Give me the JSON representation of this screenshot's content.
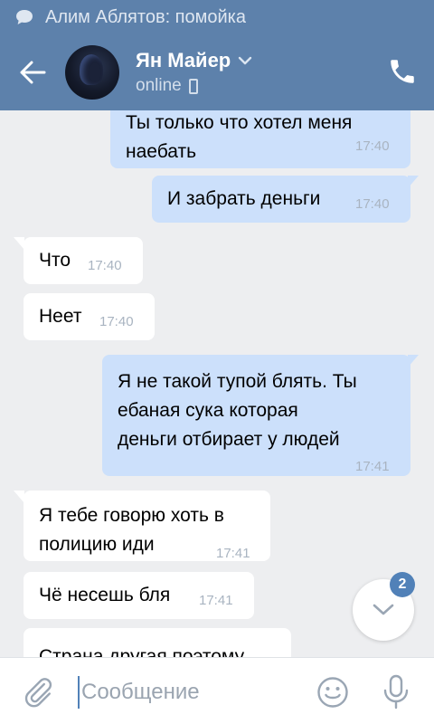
{
  "status_bar": {
    "notification_text": "Алим Аблятов: помойка"
  },
  "header": {
    "contact_name": "Ян Майер",
    "contact_status": "online"
  },
  "messages": [
    {
      "direction": "out",
      "lines": [
        "Ты только что хотел меня",
        "наебать"
      ],
      "time": "17:40"
    },
    {
      "direction": "out",
      "lines": [
        "И забрать деньги"
      ],
      "time": "17:40"
    },
    {
      "direction": "in",
      "lines": [
        "Что"
      ],
      "time": "17:40"
    },
    {
      "direction": "in",
      "lines": [
        "Неет"
      ],
      "time": "17:40"
    },
    {
      "direction": "out",
      "lines": [
        "Я не такой тупой блять. Ты",
        "ебаная сука которая",
        "деньги отбирает у людей"
      ],
      "time": "17:41"
    },
    {
      "direction": "in",
      "lines": [
        "Я тебе говорю хоть в",
        "полицию иди"
      ],
      "time": "17:41"
    },
    {
      "direction": "in",
      "lines": [
        "Чё несешь бля"
      ],
      "time": "17:41"
    },
    {
      "direction": "in",
      "lines": [
        "Страна другая поэтому"
      ],
      "time": ""
    }
  ],
  "scroll_button": {
    "badge_count": "2"
  },
  "input": {
    "placeholder": "Сообщение"
  },
  "colors": {
    "header_bg": "#5d81ab",
    "outgoing_bubble": "#cce0fb",
    "incoming_bubble": "#ffffff",
    "chat_bg": "#edeef0",
    "accent": "#5181b8"
  },
  "icons": {
    "notification": "chat-bubble-icon",
    "back": "arrow-left-icon",
    "dropdown": "chevron-down-icon",
    "device": "mobile-phone-icon",
    "call": "phone-icon",
    "scroll": "chevron-down-icon",
    "attach": "paperclip-icon",
    "emoji": "smiley-icon",
    "voice": "microphone-icon"
  }
}
